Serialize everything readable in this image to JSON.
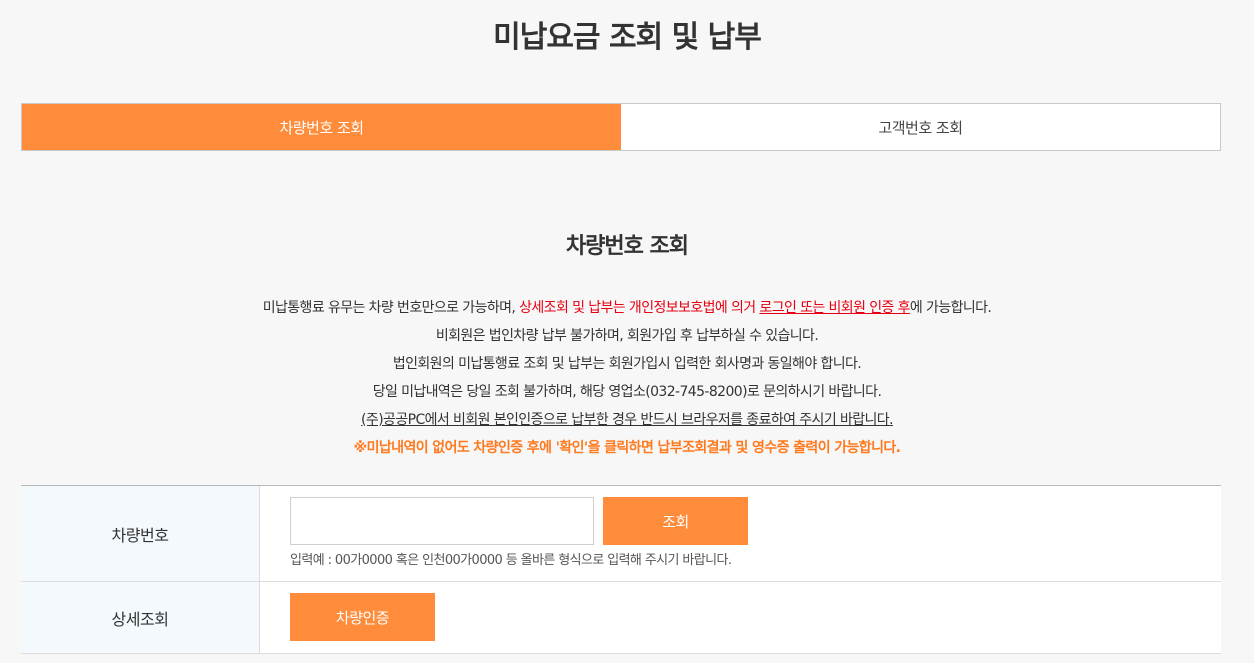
{
  "page": {
    "title": "미납요금 조회 및 납부"
  },
  "tabs": [
    {
      "label": "차량번호 조회",
      "active": true
    },
    {
      "label": "고객번호 조회",
      "active": false
    }
  ],
  "section": {
    "title": "차량번호 조회"
  },
  "notice": {
    "line1": {
      "a": "미납통행료 유무는 차량 번호만으로 가능하며, ",
      "b": "상세조회 및 납부는 개인정보보호법에 의거 ",
      "c": "로그인 또는 비회원 인증 후",
      "d": "에 가능합니다."
    },
    "line2": "비회원은 법인차량 납부 불가하며, 회원가입 후 납부하실 수 있습니다.",
    "line3": "법인회원의 미납통행료 조회 및 납부는 회원가입시 입력한 회사명과 동일해야 합니다.",
    "line4": "당일 미납내역은 당일 조회 불가하며, 해당 영업소(032-745-8200)로 문의하시기 바랍니다.",
    "line5": "(주)공공PC에서 비회원 본인인증으로 납부한 경우 반드시 브라우저를 종료하여 주시기 바랍니다.",
    "line6": "※미납내역이 없어도 차량인증 후에 '확인'을 클릭하면 납부조회결과 및 영수증 출력이 가능합니다."
  },
  "form": {
    "vehicle": {
      "label": "차량번호",
      "value": "",
      "search_label": "조회",
      "hint": "입력예 : 00가0000 혹은 인천00가0000 등 올바른 형식으로 입력해 주시기 바랍니다."
    },
    "detail": {
      "label": "상세조회",
      "auth_label": "차량인증"
    }
  },
  "colors": {
    "accent": "#ff8c3a",
    "warning_red": "#e60012",
    "label_bg": "#f3f9fd"
  }
}
